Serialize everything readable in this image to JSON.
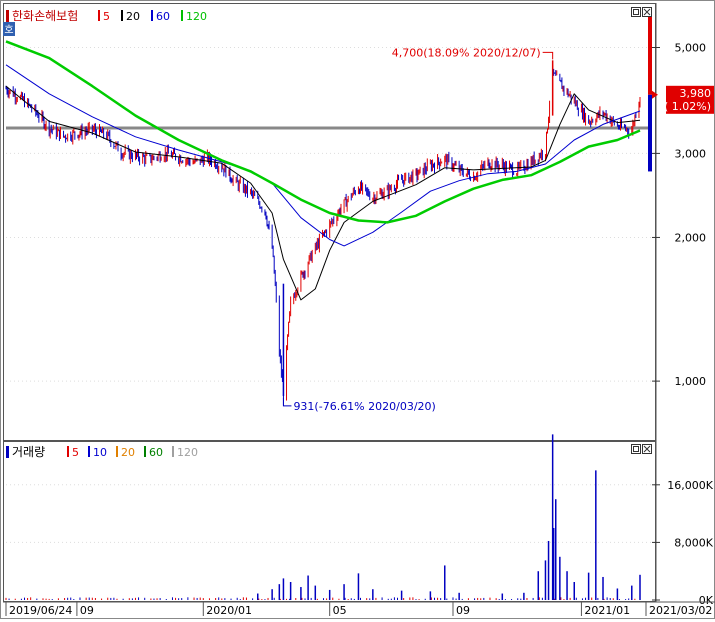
{
  "window": {
    "icon_label": "호",
    "price_title": "한화손해보험",
    "volume_title": "거래량",
    "legend_swatch_color": "#c00000"
  },
  "price_legend": [
    {
      "label": "5",
      "color": "#e00000"
    },
    {
      "label": "20",
      "color": "#000000"
    },
    {
      "label": "60",
      "color": "#0000d0"
    },
    {
      "label": "120",
      "color": "#00c000"
    }
  ],
  "volume_legend": [
    {
      "label": "5",
      "color": "#e00000"
    },
    {
      "label": "10",
      "color": "#0000d0"
    },
    {
      "label": "20",
      "color": "#e08000"
    },
    {
      "label": "60",
      "color": "#008000"
    },
    {
      "label": "120",
      "color": "#a0a0a0"
    }
  ],
  "current_price": {
    "price_label": "3,980",
    "change_label": "( 1.02%)"
  },
  "annotations": {
    "high": "4,700(18.09% 2020/12/07)",
    "low": "931(-76.61% 2020/03/20)"
  },
  "colors": {
    "up": "#e00000",
    "down": "#0000c0",
    "ma5": "#e00000",
    "ma20": "#000000",
    "ma60": "#0000d0",
    "ma120": "#00cc00",
    "hline": "#888888",
    "grid": "#cccccc"
  },
  "chart_data": [
    {
      "type": "candlestick",
      "title": "한화손해보험",
      "y_axis_ticks": [
        "5,000",
        "3,000",
        "2,000",
        "1,000"
      ],
      "y_tick_values": [
        5000,
        3000,
        2000,
        1000
      ],
      "y_scale": "log",
      "ylim": [
        760,
        6050
      ],
      "x_tick_labels": [
        "2019/06/24",
        "09",
        "2020/01",
        "05",
        "09",
        "2021/01",
        "2021/03/02"
      ],
      "x_tick_dates": [
        "2019-06-24",
        "2019-09-01",
        "2020-01-02",
        "2020-05-04",
        "2020-09-01",
        "2021-01-04",
        "2021-03-02"
      ],
      "x_range": [
        "2019-06-24",
        "2021-03-02"
      ],
      "horizontal_line": 3390,
      "high": {
        "date": "2020-12-07",
        "value": 4700
      },
      "low": {
        "date": "2020-03-20",
        "value": 931
      },
      "last": {
        "date": "2021-03-02",
        "value": 3980
      },
      "close_series": [
        [
          "2019-06-24",
          4100
        ],
        [
          "2019-07-08",
          3920
        ],
        [
          "2019-07-22",
          3680
        ],
        [
          "2019-08-05",
          3390
        ],
        [
          "2019-08-19",
          3260
        ],
        [
          "2019-09-02",
          3310
        ],
        [
          "2019-09-16",
          3370
        ],
        [
          "2019-09-30",
          3270
        ],
        [
          "2019-10-14",
          3020
        ],
        [
          "2019-10-28",
          2960
        ],
        [
          "2019-11-11",
          2920
        ],
        [
          "2019-11-25",
          3000
        ],
        [
          "2019-12-09",
          2950
        ],
        [
          "2019-12-23",
          2870
        ],
        [
          "2020-01-06",
          2930
        ],
        [
          "2020-01-20",
          2820
        ],
        [
          "2020-02-03",
          2600
        ],
        [
          "2020-02-17",
          2480
        ],
        [
          "2020-03-02",
          2280
        ],
        [
          "2020-03-09",
          1900
        ],
        [
          "2020-03-16",
          1150
        ],
        [
          "2020-03-20",
          931
        ],
        [
          "2020-03-27",
          1450
        ],
        [
          "2020-04-06",
          1650
        ],
        [
          "2020-04-20",
          1900
        ],
        [
          "2020-05-04",
          2120
        ],
        [
          "2020-05-18",
          2350
        ],
        [
          "2020-06-01",
          2550
        ],
        [
          "2020-06-15",
          2430
        ],
        [
          "2020-06-29",
          2500
        ],
        [
          "2020-07-13",
          2640
        ],
        [
          "2020-07-27",
          2700
        ],
        [
          "2020-08-10",
          2830
        ],
        [
          "2020-08-24",
          2920
        ],
        [
          "2020-09-07",
          2770
        ],
        [
          "2020-09-21",
          2680
        ],
        [
          "2020-10-05",
          2870
        ],
        [
          "2020-10-19",
          2830
        ],
        [
          "2020-11-02",
          2760
        ],
        [
          "2020-11-16",
          2880
        ],
        [
          "2020-11-30",
          3050
        ],
        [
          "2020-12-07",
          4400
        ],
        [
          "2020-12-14",
          4200
        ],
        [
          "2020-12-28",
          3850
        ],
        [
          "2021-01-11",
          3500
        ],
        [
          "2021-01-25",
          3650
        ],
        [
          "2021-02-08",
          3420
        ],
        [
          "2021-02-22",
          3350
        ],
        [
          "2021-03-02",
          3980
        ]
      ],
      "moving_averages": [
        {
          "name": "20",
          "points": [
            [
              "2019-06-24",
              4150
            ],
            [
              "2019-08-05",
              3500
            ],
            [
              "2019-09-16",
              3310
            ],
            [
              "2019-10-28",
              3020
            ],
            [
              "2019-12-09",
              2950
            ],
            [
              "2020-01-20",
              2860
            ],
            [
              "2020-02-17",
              2600
            ],
            [
              "2020-03-09",
              2250
            ],
            [
              "2020-03-20",
              1800
            ],
            [
              "2020-04-06",
              1480
            ],
            [
              "2020-04-20",
              1560
            ],
            [
              "2020-05-04",
              1880
            ],
            [
              "2020-05-18",
              2150
            ],
            [
              "2020-06-15",
              2380
            ],
            [
              "2020-07-27",
              2580
            ],
            [
              "2020-08-24",
              2800
            ],
            [
              "2020-09-21",
              2770
            ],
            [
              "2020-10-19",
              2790
            ],
            [
              "2020-11-16",
              2810
            ],
            [
              "2020-11-30",
              2900
            ],
            [
              "2020-12-14",
              3450
            ],
            [
              "2020-12-28",
              4000
            ],
            [
              "2021-01-11",
              3700
            ],
            [
              "2021-02-08",
              3480
            ],
            [
              "2021-03-02",
              3520
            ]
          ]
        },
        {
          "name": "60",
          "points": [
            [
              "2019-06-24",
              4600
            ],
            [
              "2019-08-05",
              4000
            ],
            [
              "2019-09-16",
              3580
            ],
            [
              "2019-10-28",
              3250
            ],
            [
              "2019-12-09",
              3050
            ],
            [
              "2020-01-20",
              2880
            ],
            [
              "2020-02-17",
              2760
            ],
            [
              "2020-03-09",
              2600
            ],
            [
              "2020-04-06",
              2200
            ],
            [
              "2020-05-04",
              1980
            ],
            [
              "2020-05-18",
              1920
            ],
            [
              "2020-06-15",
              2050
            ],
            [
              "2020-07-13",
              2260
            ],
            [
              "2020-08-10",
              2500
            ],
            [
              "2020-09-07",
              2630
            ],
            [
              "2020-10-05",
              2720
            ],
            [
              "2020-11-02",
              2750
            ],
            [
              "2020-11-30",
              2850
            ],
            [
              "2020-12-28",
              3200
            ],
            [
              "2021-01-25",
              3450
            ],
            [
              "2021-03-02",
              3680
            ]
          ]
        },
        {
          "name": "120",
          "points": [
            [
              "2019-06-24",
              5150
            ],
            [
              "2019-08-05",
              4750
            ],
            [
              "2019-09-16",
              4150
            ],
            [
              "2019-10-28",
              3600
            ],
            [
              "2019-12-09",
              3200
            ],
            [
              "2020-01-20",
              2900
            ],
            [
              "2020-02-17",
              2750
            ],
            [
              "2020-03-09",
              2600
            ],
            [
              "2020-04-06",
              2400
            ],
            [
              "2020-05-04",
              2250
            ],
            [
              "2020-06-01",
              2170
            ],
            [
              "2020-06-29",
              2150
            ],
            [
              "2020-07-27",
              2220
            ],
            [
              "2020-08-24",
              2380
            ],
            [
              "2020-09-21",
              2530
            ],
            [
              "2020-10-19",
              2640
            ],
            [
              "2020-11-16",
              2700
            ],
            [
              "2020-12-14",
              2880
            ],
            [
              "2021-01-11",
              3100
            ],
            [
              "2021-02-08",
              3200
            ],
            [
              "2021-03-02",
              3350
            ]
          ]
        }
      ]
    },
    {
      "type": "bar",
      "title": "거래량",
      "y_axis_ticks": [
        "16,000K",
        "8,000K",
        "0K"
      ],
      "y_tick_values": [
        16000,
        8000,
        0
      ],
      "ylim": [
        0,
        20000
      ],
      "units": "K",
      "series": [
        {
          "name": "volume",
          "points": [
            [
              "2020-02-24",
              900
            ],
            [
              "2020-03-09",
              1500
            ],
            [
              "2020-03-16",
              2200
            ],
            [
              "2020-03-20",
              3000
            ],
            [
              "2020-03-27",
              2500
            ],
            [
              "2020-04-06",
              1800
            ],
            [
              "2020-04-13",
              3400
            ],
            [
              "2020-04-20",
              2000
            ],
            [
              "2020-05-04",
              1400
            ],
            [
              "2020-05-18",
              2200
            ],
            [
              "2020-06-01",
              3700
            ],
            [
              "2020-06-15",
              1500
            ],
            [
              "2020-07-13",
              1300
            ],
            [
              "2020-08-10",
              1200
            ],
            [
              "2020-08-24",
              4800
            ],
            [
              "2020-09-07",
              1000
            ],
            [
              "2020-10-19",
              900
            ],
            [
              "2020-11-09",
              1000
            ],
            [
              "2020-11-23",
              4000
            ],
            [
              "2020-11-30",
              5500
            ],
            [
              "2020-12-03",
              8200
            ],
            [
              "2020-12-07",
              23000
            ],
            [
              "2020-12-08",
              10000
            ],
            [
              "2020-12-10",
              14000
            ],
            [
              "2020-12-14",
              6000
            ],
            [
              "2020-12-21",
              4000
            ],
            [
              "2020-12-28",
              2500
            ],
            [
              "2021-01-11",
              3800
            ],
            [
              "2021-01-18",
              18000
            ],
            [
              "2021-01-25",
              3200
            ],
            [
              "2021-02-08",
              1600
            ],
            [
              "2021-02-22",
              2000
            ],
            [
              "2021-03-02",
              3500
            ]
          ]
        }
      ]
    }
  ]
}
